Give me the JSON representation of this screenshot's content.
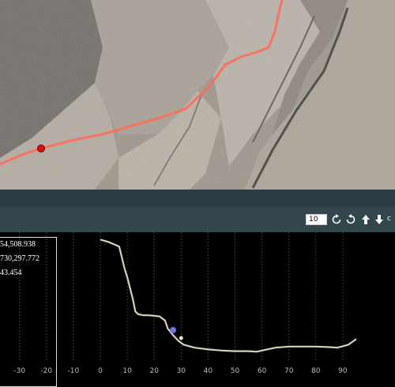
{
  "toolbar": {
    "zoom_value": "10",
    "rotate_cw_icon": "rotate-cw-icon",
    "rotate_ccw_icon": "rotate-ccw-icon",
    "up_icon": "arrow-up-icon",
    "down_icon": "arrow-down-icon",
    "extra_label": "c"
  },
  "coords": {
    "x_value": "54,508.938",
    "y_value": "730,297.772",
    "z_value": "43.454"
  },
  "colors": {
    "profile_line": "#d8d0b8",
    "track": "#ff6a5a",
    "marker": "#e01010",
    "panel_header": "#2c3e43",
    "toolbar": "#32464c"
  },
  "chart_data": {
    "type": "line",
    "x_ticks": [
      "-30",
      "-20",
      "-10",
      "0",
      "10",
      "20",
      "30",
      "40",
      "50",
      "60",
      "70",
      "80",
      "90"
    ],
    "xlim": [
      -30,
      95
    ],
    "series": [
      {
        "x": [
          0,
          3,
          7,
          9,
          10,
          12,
          13,
          14,
          16,
          18,
          20,
          22,
          24,
          25,
          27,
          29,
          31,
          35,
          40,
          45,
          50,
          55,
          58,
          60,
          65,
          70,
          75,
          80,
          85,
          88,
          92,
          95
        ],
        "elev": [
          42.3,
          41.9,
          41.1,
          37.2,
          35.7,
          32.0,
          29.7,
          29.2,
          29.0,
          29.0,
          28.9,
          28.8,
          28.1,
          26.7,
          25.5,
          24.5,
          23.8,
          23.3,
          23.0,
          22.8,
          22.7,
          22.7,
          22.6,
          22.8,
          23.3,
          23.5,
          23.5,
          23.5,
          23.4,
          23.3,
          23.8,
          24.8
        ]
      }
    ],
    "cursor": {
      "x": 27,
      "elev": 26.4
    },
    "marker2": {
      "x": 30,
      "elev": 25.0
    }
  }
}
